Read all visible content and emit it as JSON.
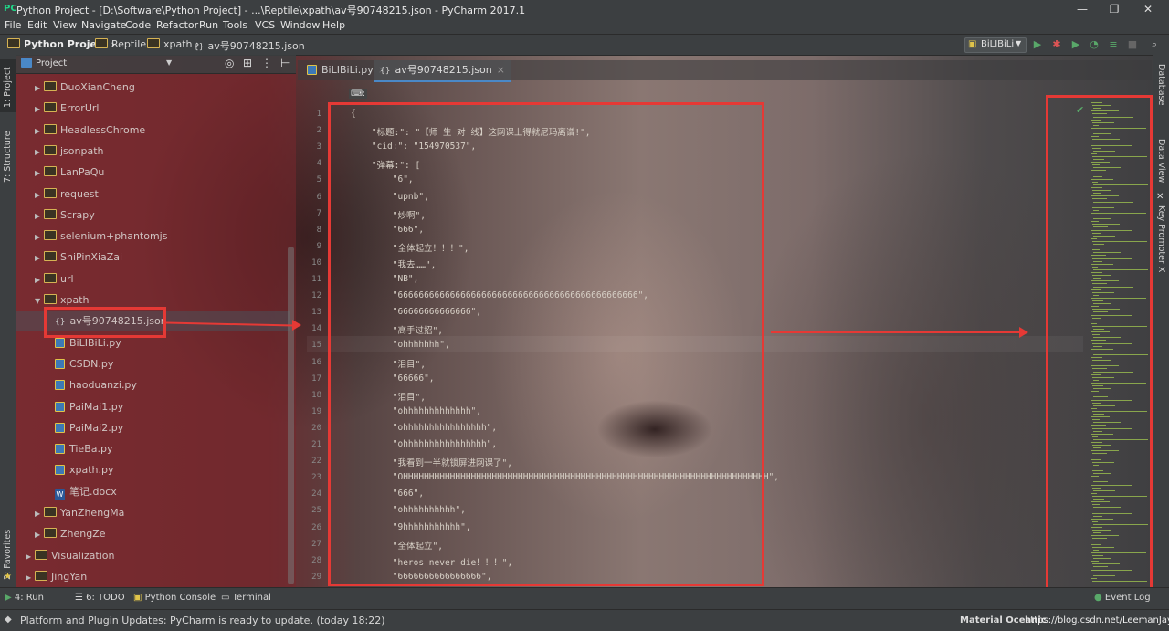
{
  "window": {
    "title": "Python Project - [D:\\Software\\Python Project] - ...\\Reptile\\xpath\\av号90748215.json - PyCharm 2017.1",
    "controls": {
      "minimize": "—",
      "restore": "❐",
      "close": "✕"
    }
  },
  "menu": [
    "File",
    "Edit",
    "View",
    "Navigate",
    "Code",
    "Refactor",
    "Run",
    "Tools",
    "VCS",
    "Window",
    "Help"
  ],
  "breadcrumbs": [
    "Python Project",
    "Reptile",
    "xpath",
    "av号90748215.json"
  ],
  "run_config": "BiLIBiLi",
  "left_strip": {
    "project": "1: Project",
    "structure": "7: Structure",
    "favorites": "2: Favorites"
  },
  "right_strip": {
    "database": "Database",
    "dataview": "Data View",
    "keypromoter": "Key Promoter X"
  },
  "project_panel": {
    "header": "Project",
    "tree": [
      {
        "label": "DuoXianCheng",
        "kind": "folder"
      },
      {
        "label": "ErrorUrl",
        "kind": "folder"
      },
      {
        "label": "HeadlessChrome",
        "kind": "folder"
      },
      {
        "label": "jsonpath",
        "kind": "folder"
      },
      {
        "label": "LanPaQu",
        "kind": "folder"
      },
      {
        "label": "request",
        "kind": "folder"
      },
      {
        "label": "Scrapy",
        "kind": "folder"
      },
      {
        "label": "selenium+phantomjs",
        "kind": "folder"
      },
      {
        "label": "ShiPinXiaZai",
        "kind": "folder"
      },
      {
        "label": "url",
        "kind": "folder"
      },
      {
        "label": "xpath",
        "kind": "folder-open"
      },
      {
        "label": "av号90748215.json",
        "kind": "json"
      },
      {
        "label": "BiLIBiLi.py",
        "kind": "py"
      },
      {
        "label": "CSDN.py",
        "kind": "py"
      },
      {
        "label": "haoduanzi.py",
        "kind": "py"
      },
      {
        "label": "PaiMai1.py",
        "kind": "py"
      },
      {
        "label": "PaiMai2.py",
        "kind": "py"
      },
      {
        "label": "TieBa.py",
        "kind": "py"
      },
      {
        "label": "xpath.py",
        "kind": "py"
      },
      {
        "label": "笔记.docx",
        "kind": "doc"
      },
      {
        "label": "YanZhengMa",
        "kind": "folder"
      },
      {
        "label": "ZhengZe",
        "kind": "folder"
      },
      {
        "label": "Visualization",
        "kind": "folder"
      },
      {
        "label": "JingYan",
        "kind": "folder"
      }
    ]
  },
  "tabs": [
    {
      "label": "BiLIBiLi.py",
      "active": false
    },
    {
      "label": "av号90748215.json",
      "active": true
    }
  ],
  "editor": {
    "line_numbers": [
      "1",
      "2",
      "3",
      "4",
      "5",
      "6",
      "7",
      "8",
      "9",
      "10",
      "11",
      "12",
      "13",
      "14",
      "15",
      "16",
      "17",
      "18",
      "19",
      "20",
      "21",
      "22",
      "23",
      "24",
      "25",
      "26",
      "27",
      "28",
      "29"
    ],
    "lines": [
      "{",
      "    \"标题:\": \"【师 生 对 线】这网课上得就尼玛离谱!\",",
      "    \"cid:\": \"154970537\",",
      "    \"弹幕:\": [",
      "        \"6\",",
      "        \"upnb\",",
      "        \"炒啊\",",
      "        \"666\",",
      "        \"全体起立！！！\",",
      "        \"我去……\",",
      "        \"NB\",",
      "        \"6666666666666666666666666666666666666666666666\",",
      "        \"66666666666666\",",
      "        \"高手过招\",",
      "        \"ohhhhhhh\",",
      "        \"泪目\",",
      "        \"66666\",",
      "        \"泪目\",",
      "        \"ohhhhhhhhhhhhh\",",
      "        \"ohhhhhhhhhhhhhhhh\",",
      "        \"ohhhhhhhhhhhhhhhh\",",
      "        \"我看到一半就锁屏进网课了\",",
      "        \"OHHHHHHHHHHHHHHHHHHHHHHHHHHHHHHHHHHHHHHHHHHHHHHHHHHHHHHHHHHHHHHHHHHHHHH\",",
      "        \"666\",",
      "        \"ohhhhhhhhhh\",",
      "        \"9hhhhhhhhhhh\",",
      "        \"全体起立\",",
      "        \"heros never die！！！\",",
      "        \"6666666666666666\","
    ],
    "breadcrumb_hint": "⌨:"
  },
  "bottom_tools": [
    {
      "label": "4: Run"
    },
    {
      "label": "6: TODO"
    },
    {
      "label": "Python Console"
    },
    {
      "label": "Terminal"
    },
    {
      "label": "Event Log"
    }
  ],
  "status": {
    "message": "Platform and Plugin Updates: PyCharm is ready to update. (today 18:22)",
    "theme": "Material Oceanic",
    "watermark": "https://blog.csdn.net/LeemanJay"
  }
}
